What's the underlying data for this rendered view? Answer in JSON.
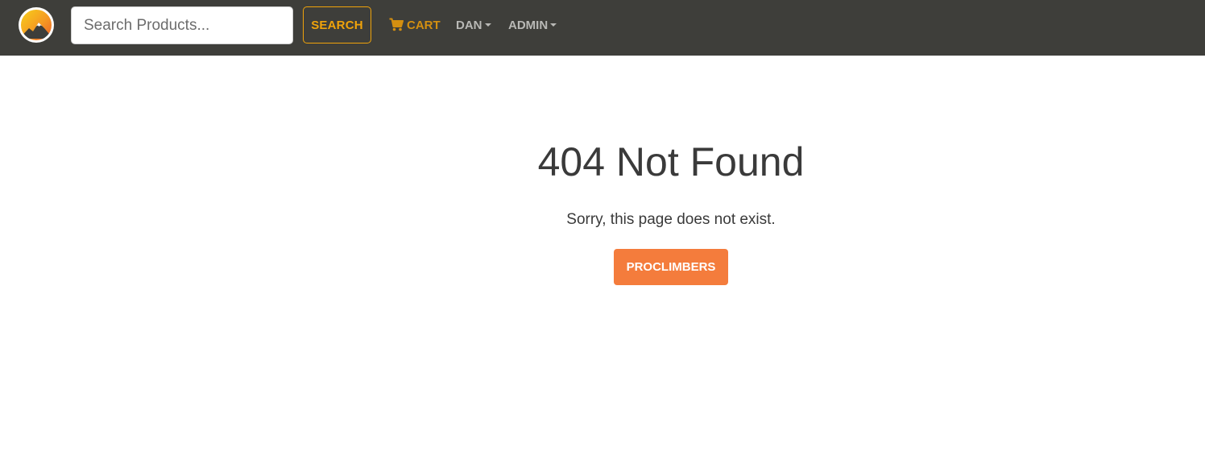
{
  "header": {
    "logo_icon": "mountain-sun-logo-icon",
    "search": {
      "placeholder": "Search Products...",
      "value": ""
    },
    "search_button_label": "SEARCH",
    "cart": {
      "icon": "shopping-cart-icon",
      "label": "CART"
    },
    "user_menu_label": "DAN",
    "admin_menu_label": "ADMIN"
  },
  "main": {
    "title": "404 Not Found",
    "message": "Sorry, this page does not exist.",
    "home_button_label": "PROCLIMBERS"
  },
  "colors": {
    "navbar_bg": "#3e3e3a",
    "accent_orange": "#f47c3c",
    "search_accent": "#f0a30a",
    "cart_text": "#d48f10",
    "nav_text": "#b9b9b6",
    "body_text": "#3a3a3a"
  }
}
